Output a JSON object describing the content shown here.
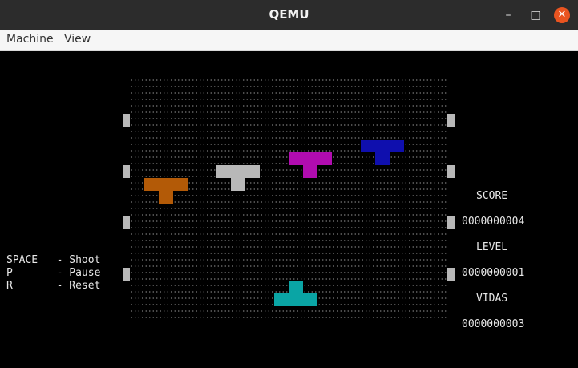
{
  "window": {
    "title": "QEMU",
    "minimize_glyph": "–",
    "maximize_glyph": "□",
    "close_glyph": "✕"
  },
  "menu": {
    "items": [
      "Machine",
      "View"
    ]
  },
  "game": {
    "controls": [
      {
        "key": "SPACE",
        "sep": "-",
        "action": "Shoot"
      },
      {
        "key": "P",
        "sep": "-",
        "action": "Pause"
      },
      {
        "key": "R",
        "sep": "-",
        "action": "Reset"
      }
    ],
    "score_label": "SCORE",
    "score_value": "0000000004",
    "level_label": "LEVEL",
    "level_value": "0000000001",
    "lives_label": "VIDAS",
    "lives_value": "0000000003",
    "colors": {
      "enemy_orange": "#b35a07",
      "enemy_gray": "#b8b8b8",
      "enemy_magenta": "#b10cb0",
      "enemy_blue": "#0f0fae",
      "player_teal": "#0aa5a5",
      "wall": "#b8b8b8",
      "text": "#e8e8e8"
    }
  }
}
